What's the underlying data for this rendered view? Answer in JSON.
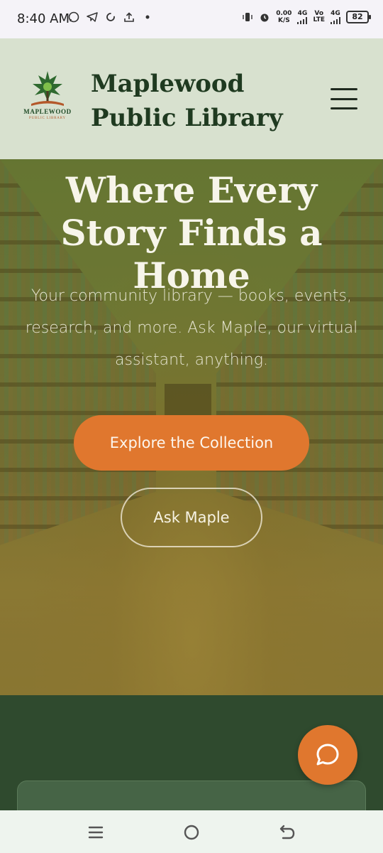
{
  "status_bar": {
    "time": "8:40 AM",
    "net_speed_value": "0.00",
    "net_speed_unit": "K/S",
    "network_1": "4G",
    "network_2_top": "Vo",
    "network_2_bottom": "LTE",
    "network_3": "4G",
    "battery": "82",
    "icons_left": [
      "whatsapp-icon",
      "telegram-icon",
      "sync-icon",
      "upload-icon",
      "dot-icon"
    ],
    "icons_right": [
      "vibrate-icon",
      "alarm-icon",
      "signal-icon",
      "battery-icon"
    ]
  },
  "header": {
    "logo_main": "MAPLEWOOD",
    "logo_sub": "PUBLIC LIBRARY",
    "site_name": "Maplewood Public Library",
    "menu_icon": "hamburger-menu-icon"
  },
  "hero": {
    "title": "Where Every Story Finds a Home",
    "subtitle": "Your community library — books, events, research, and more. Ask Maple, our virtual assistant, anything.",
    "primary_button": "Explore the Collection",
    "secondary_button": "Ask Maple"
  },
  "chat": {
    "icon": "chat-bubble-icon"
  },
  "colors": {
    "header_bg": "#d8e1cf",
    "accent_orange": "#e0772e",
    "dark_green": "#2f4a2e",
    "title_green": "#1f3a20"
  },
  "nav_bar": {
    "icons": [
      "recent-apps-icon",
      "home-icon",
      "back-icon"
    ]
  }
}
